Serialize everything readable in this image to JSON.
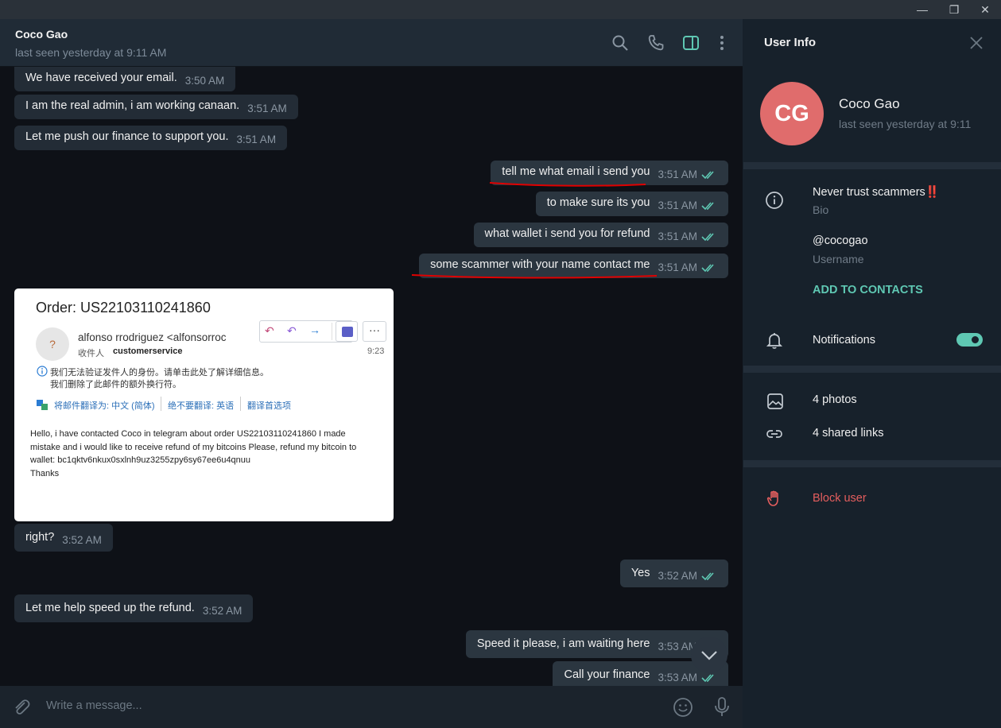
{
  "window": {
    "minimize_glyph": "—",
    "restore_glyph": "❐",
    "close_glyph": "✕"
  },
  "chat": {
    "title": "Coco Gao",
    "status": "last seen yesterday at 9:11 AM",
    "messages": [
      {
        "text": "We have received your email.",
        "time": "3:50 AM"
      },
      {
        "text": "I am the real admin, i am working canaan.",
        "time": "3:51 AM"
      },
      {
        "text": "Let me push our finance to support you.",
        "time": "3:51 AM"
      },
      {
        "text": "tell me what email i send you",
        "time": "3:51 AM"
      },
      {
        "text": "to make sure its you",
        "time": "3:51 AM"
      },
      {
        "text": "what wallet i send you for refund",
        "time": "3:51 AM"
      },
      {
        "text": "some scammer with your name contact me",
        "time": "3:51 AM"
      },
      {
        "text": "right?",
        "time": "3:52 AM"
      },
      {
        "text": "Yes",
        "time": "3:52 AM"
      },
      {
        "text": "Let me help speed up the refund.",
        "time": "3:52 AM"
      },
      {
        "text": "Speed it please, i am waiting here",
        "time": "3:53 AM"
      },
      {
        "text": "Call your finance",
        "time": "3:53 AM"
      }
    ],
    "email": {
      "subject": "Order: US22103110241860",
      "avatar_glyph": "?",
      "sender": "alfonso rrodriguez <alfonsorroc",
      "to_label": "收件人",
      "to_value": "customerservice",
      "time": "9:23",
      "warning_line1": "我们无法验证发件人的身份。请单击此处了解详细信息。",
      "warning_line2": "我们删除了此邮件的额外换行符。",
      "translate": "将邮件翻译为: 中文 (简体)",
      "no_translate": "绝不要翻译: 英语",
      "translate_prefs": "翻译首选项",
      "body_line1": "Hello, i have contacted Coco in telegram about order US22103110241860 I made",
      "body_line2": "mistake and i would like to receive refund of my bitcoins Please, refund my bitcoin to",
      "body_line3": "wallet: bc1qktv6nkux0sxlnh9uz3255zpy6sy67ee6u4qnuu",
      "body_line4": "Thanks"
    },
    "composer_placeholder": "Write a message..."
  },
  "panel": {
    "title": "User Info",
    "avatar_initials": "CG",
    "avatar_color": "#e06c6c",
    "name": "Coco Gao",
    "status": "last seen yesterday at 9:11",
    "bio": "Never trust scammers‼️",
    "bio_label": "Bio",
    "username": "@cocogao",
    "username_label": "Username",
    "add_contacts": "ADD TO CONTACTS",
    "notifications": "Notifications",
    "notifications_on": true,
    "photos": "4 photos",
    "links": "4 shared links",
    "block": "Block user"
  },
  "colors": {
    "accent": "#5fc8b3",
    "danger": "#e55e5e",
    "underline": "#e00000"
  }
}
